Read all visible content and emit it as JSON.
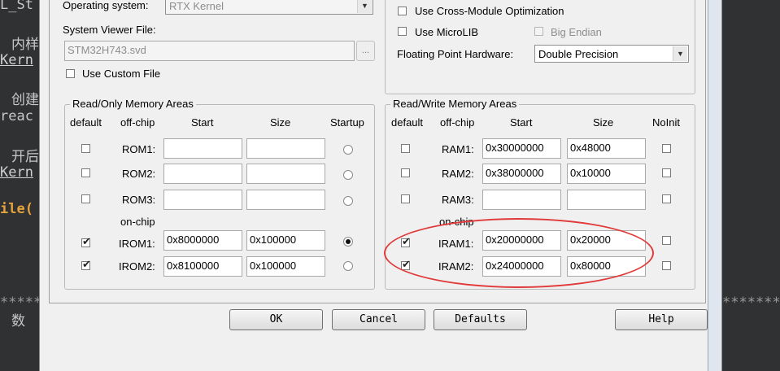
{
  "background_code": {
    "line1": "L_St",
    "line2": "内样",
    "line3": "Kern",
    "line4": "创建",
    "line5": "reac",
    "line6": "开后",
    "line7": "Kern",
    "line8": "ile(",
    "stars_left": "*****",
    "stars_right": "*******",
    "line9": "数"
  },
  "top_section": {
    "os_label": "Operating system:",
    "os_value": "RTX Kernel",
    "sysviewer_label": "System Viewer File:",
    "sysviewer_value": "STM32H743.svd",
    "browse_label": "...",
    "custom_file_label": "Use Custom File",
    "cross_module_label": "Use Cross-Module Optimization",
    "microlib_label": "Use MicroLIB",
    "big_endian_label": "Big Endian",
    "fph_label": "Floating Point Hardware:",
    "fph_value": "Double Precision"
  },
  "ro_memory": {
    "title": "Read/Only Memory Areas",
    "headers": {
      "default": "default",
      "offchip": "off-chip",
      "start": "Start",
      "size": "Size",
      "startup": "Startup"
    },
    "onchip_label": "on-chip",
    "rows": [
      {
        "name": "ROM1:",
        "start": "",
        "size": "",
        "default": false,
        "startup": false
      },
      {
        "name": "ROM2:",
        "start": "",
        "size": "",
        "default": false,
        "startup": false
      },
      {
        "name": "ROM3:",
        "start": "",
        "size": "",
        "default": false,
        "startup": false
      },
      {
        "name": "IROM1:",
        "start": "0x8000000",
        "size": "0x100000",
        "default": true,
        "startup": true
      },
      {
        "name": "IROM2:",
        "start": "0x8100000",
        "size": "0x100000",
        "default": true,
        "startup": false
      }
    ]
  },
  "rw_memory": {
    "title": "Read/Write Memory Areas",
    "headers": {
      "default": "default",
      "offchip": "off-chip",
      "start": "Start",
      "size": "Size",
      "noinit": "NoInit"
    },
    "onchip_label": "on-chip",
    "rows": [
      {
        "name": "RAM1:",
        "start": "0x30000000",
        "size": "0x48000",
        "default": false,
        "noinit": false
      },
      {
        "name": "RAM2:",
        "start": "0x38000000",
        "size": "0x10000",
        "default": false,
        "noinit": false
      },
      {
        "name": "RAM3:",
        "start": "",
        "size": "",
        "default": false,
        "noinit": false
      },
      {
        "name": "IRAM1:",
        "start": "0x20000000",
        "size": "0x20000",
        "default": true,
        "noinit": false
      },
      {
        "name": "IRAM2:",
        "start": "0x24000000",
        "size": "0x80000",
        "default": true,
        "noinit": false
      }
    ]
  },
  "buttons": {
    "ok": "OK",
    "cancel": "Cancel",
    "defaults": "Defaults",
    "help": "Help"
  },
  "colors": {
    "annotation": "#e03a3a",
    "dialog_bg": "#f0f0f0",
    "editor_bg": "#2f3132"
  }
}
